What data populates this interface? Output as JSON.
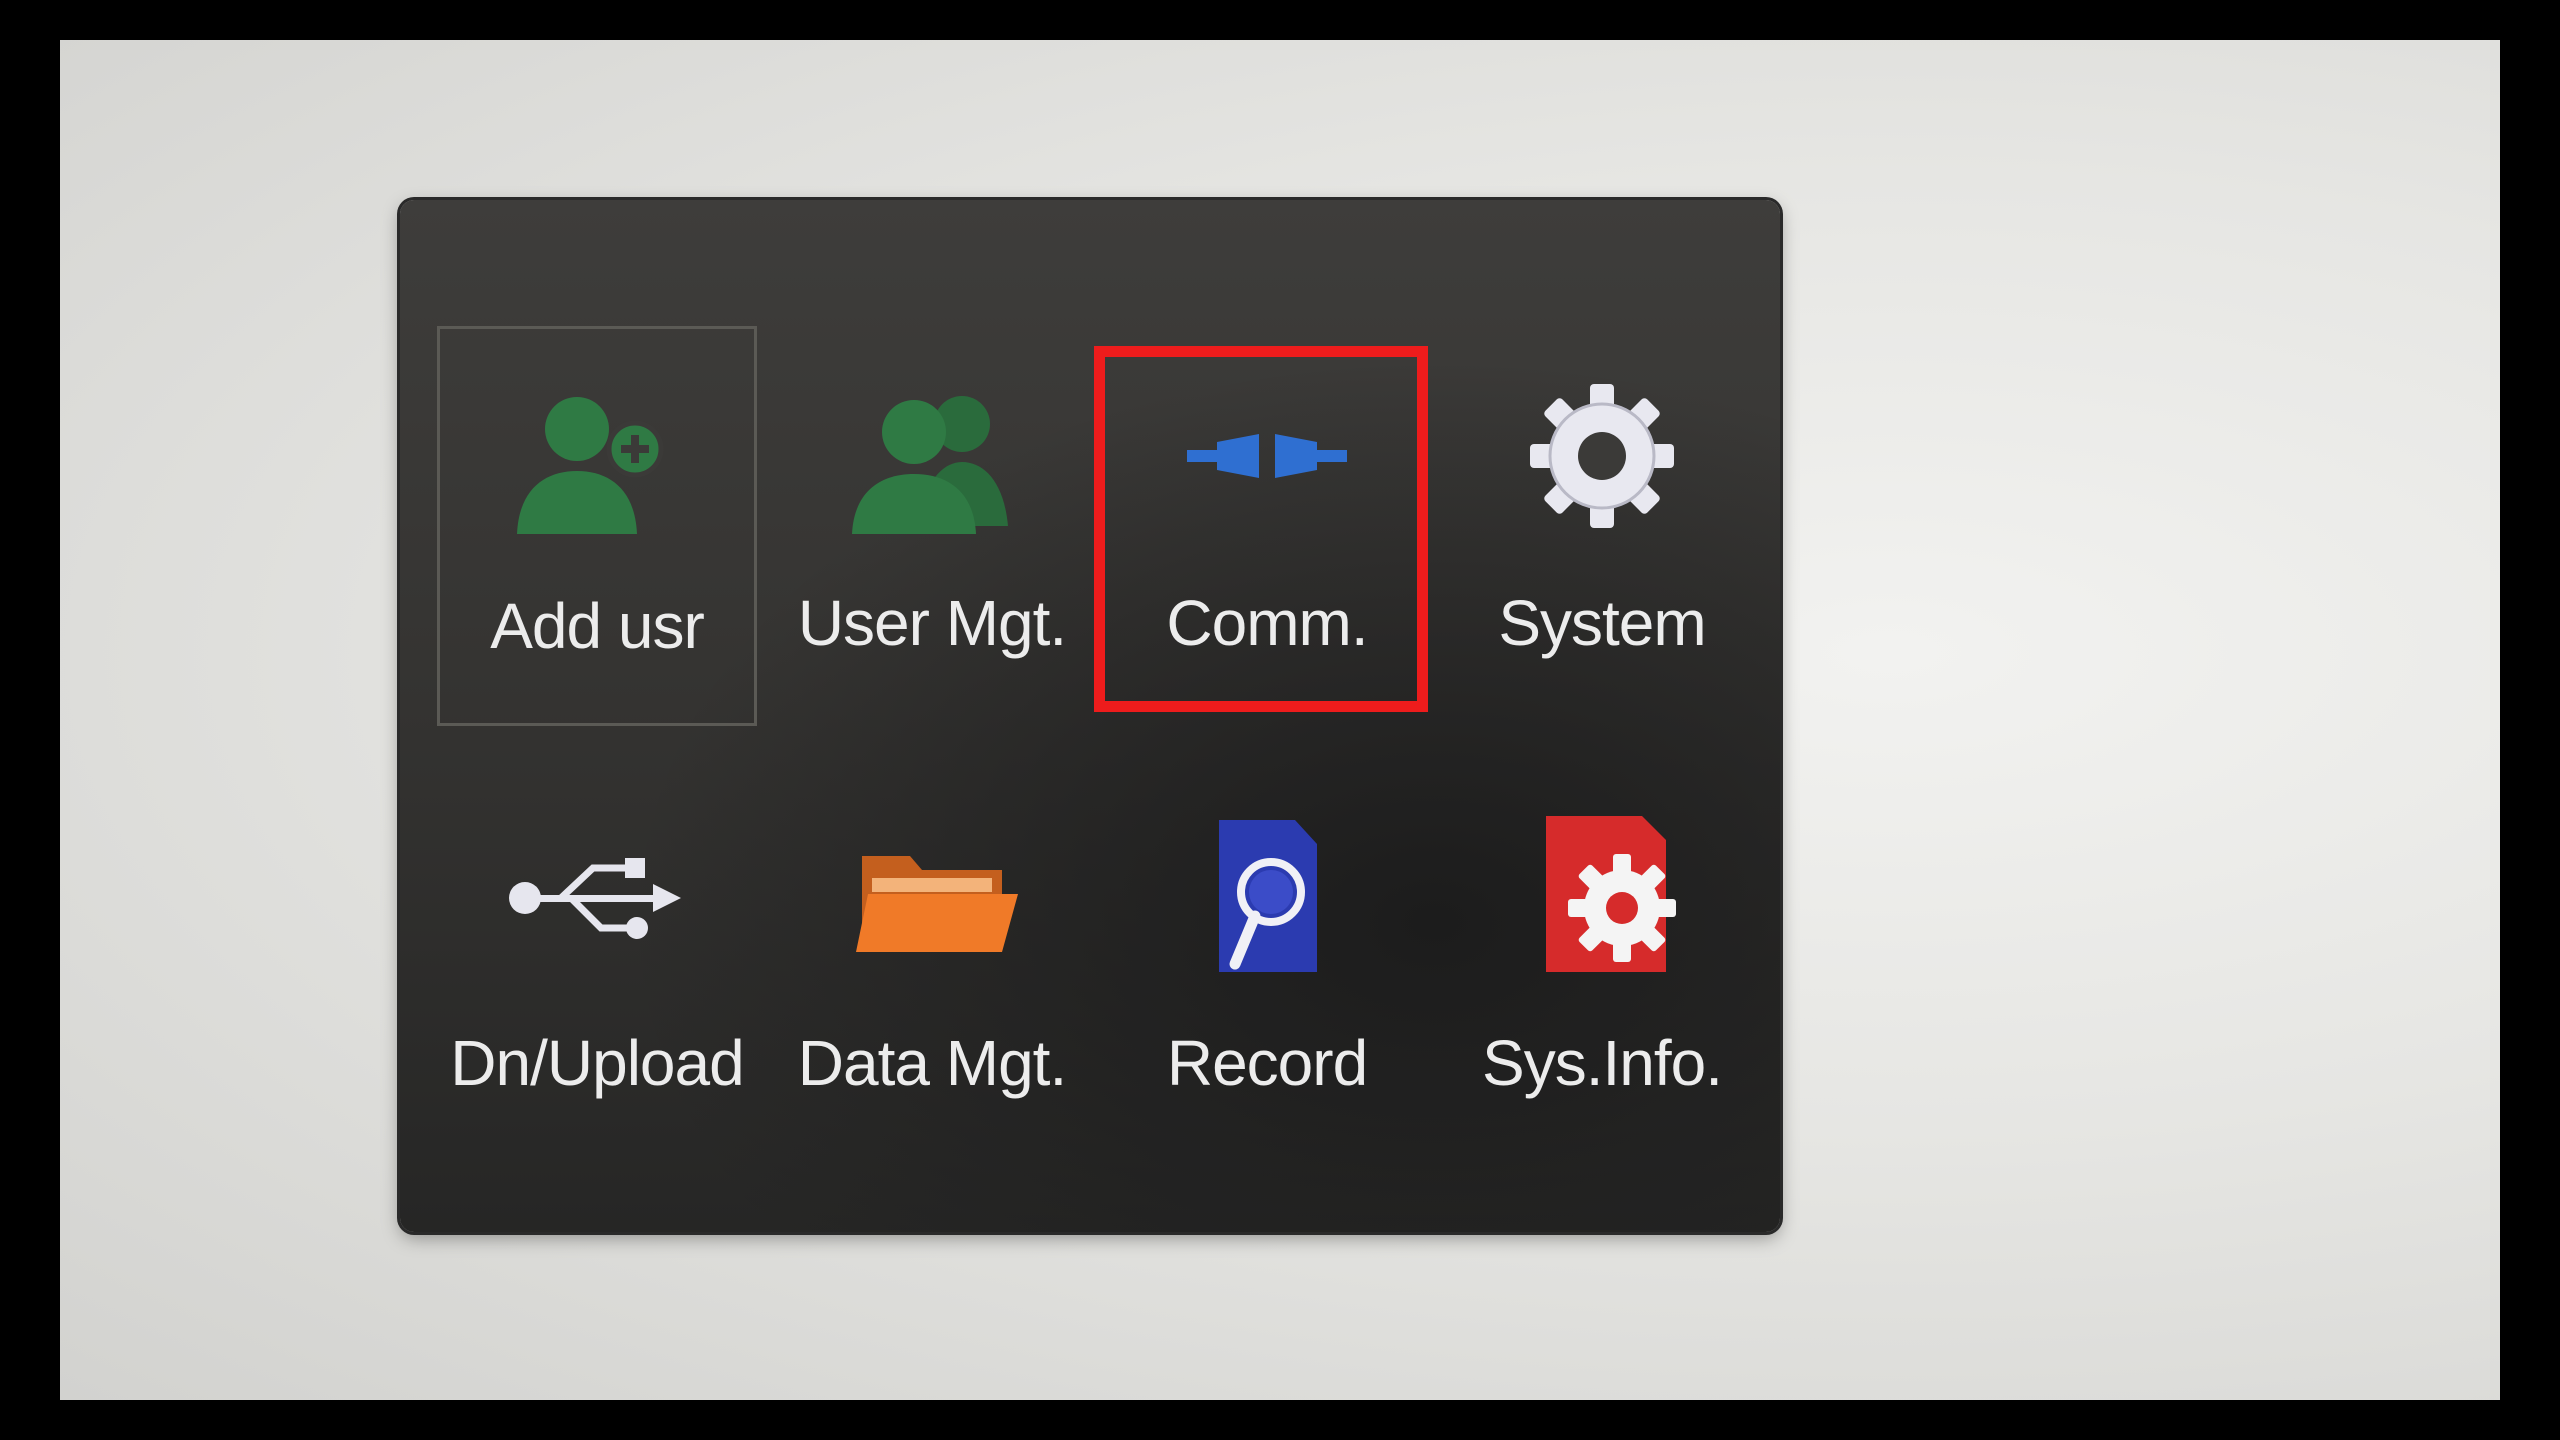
{
  "menu": {
    "items": [
      {
        "label": "Add usr",
        "icon": "add-user-icon",
        "color": "#2f7a44"
      },
      {
        "label": "User Mgt.",
        "icon": "users-icon",
        "color": "#2f7a44"
      },
      {
        "label": "Comm.",
        "icon": "network-plug-icon",
        "color": "#2f6fd1"
      },
      {
        "label": "System",
        "icon": "gear-icon",
        "color": "#e6e6ee"
      },
      {
        "label": "Dn/Upload",
        "icon": "usb-icon",
        "color": "#e6e6ee"
      },
      {
        "label": "Data Mgt.",
        "icon": "folder-icon",
        "color": "#f07a28"
      },
      {
        "label": "Record",
        "icon": "record-search-icon",
        "color": "#2b3bb0"
      },
      {
        "label": "Sys.Info.",
        "icon": "system-info-icon",
        "color": "#d62b2b"
      }
    ],
    "selected_index": 0,
    "highlighted_index": 2,
    "highlight_color": "#ee1c1c"
  }
}
